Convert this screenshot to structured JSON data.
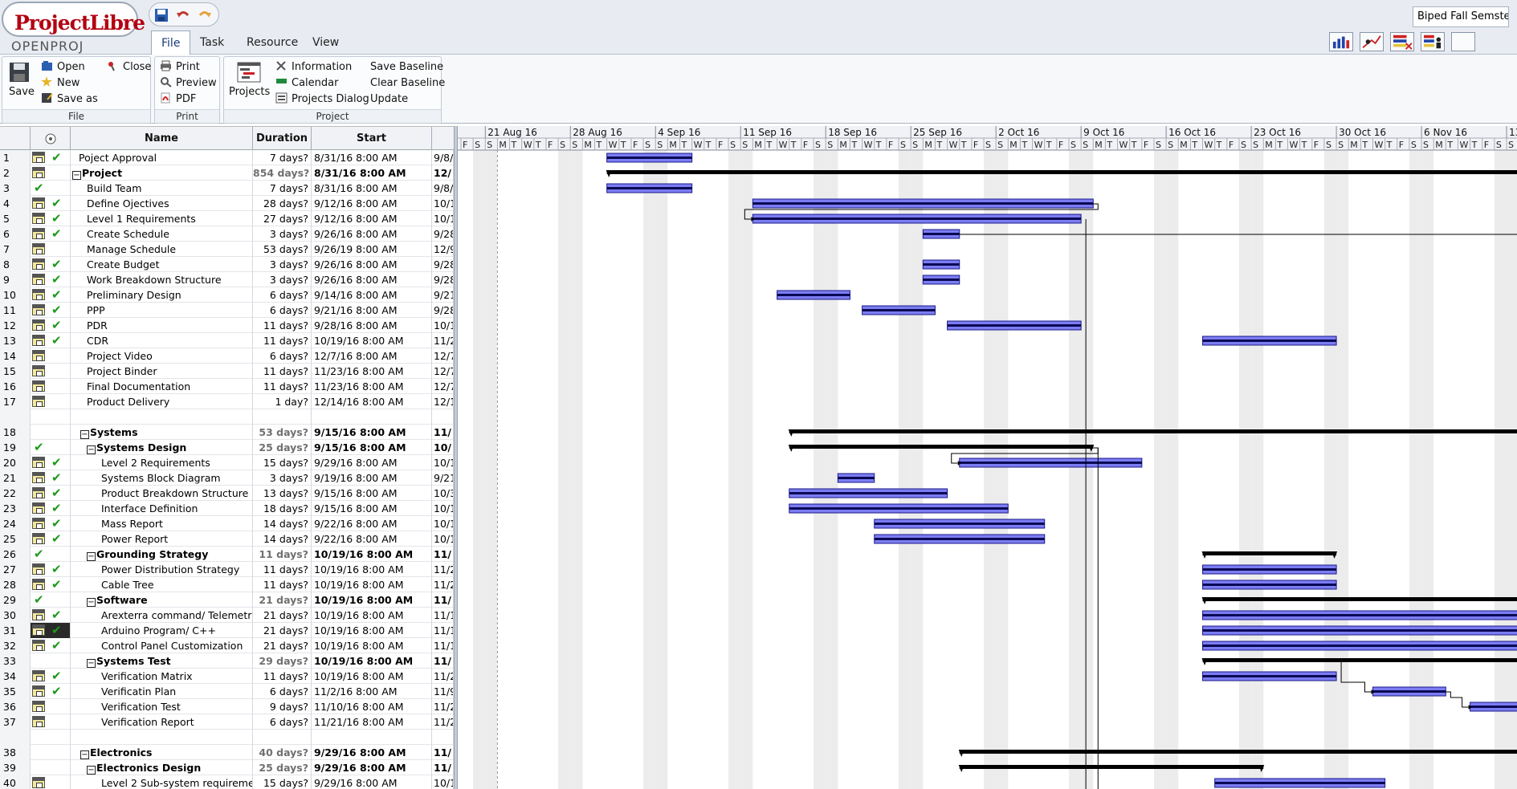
{
  "app": {
    "logo_text": "ProjectLibre",
    "logo_sub": "OPENPROJ",
    "document_name": "Biped Fall Semste..."
  },
  "tabs": [
    {
      "label": "File",
      "active": true
    },
    {
      "label": "Task",
      "active": false
    },
    {
      "label": "Resource",
      "active": false
    },
    {
      "label": "View",
      "active": false
    }
  ],
  "ribbon": {
    "file_group": {
      "label": "File",
      "save": "Save",
      "open": "Open",
      "close": "Close",
      "new": "New",
      "save_as": "Save as"
    },
    "print_group": {
      "label": "Print",
      "print": "Print",
      "preview": "Preview",
      "pdf": "PDF"
    },
    "project_group": {
      "label": "Project",
      "projects": "Projects",
      "information": "Information",
      "calendar": "Calendar",
      "projects_dialog": "Projects Dialog",
      "save_baseline": "Save Baseline",
      "clear_baseline": "Clear Baseline",
      "update": "Update"
    }
  },
  "columns": {
    "name": "Name",
    "duration": "Duration",
    "start": "Start"
  },
  "timeline": {
    "weeks": [
      "21 Aug 16",
      "28 Aug 16",
      "4 Sep 16",
      "11 Sep 16",
      "18 Sep 16",
      "25 Sep 16",
      "2 Oct 16",
      "9 Oct 16",
      "16 Oct 16",
      "23 Oct 16",
      "30 Oct 16",
      "6 Nov 16",
      "13 N"
    ],
    "day_letters": [
      "S",
      "M",
      "T",
      "W",
      "T",
      "F",
      "S"
    ]
  },
  "tasks": [
    {
      "id": "1",
      "name": "Poject Approval",
      "duration": "7 days?",
      "start": "8/31/16 8:00 AM",
      "finish": "9/8/",
      "level": 1,
      "cal": true,
      "check": "b"
    },
    {
      "id": "2",
      "name": "Project",
      "duration": "854 days?",
      "start": "8/31/16 8:00 AM",
      "finish": "12/",
      "level": 0,
      "summary": true,
      "cal": true
    },
    {
      "id": "3",
      "name": "Build Team",
      "duration": "7 days?",
      "start": "8/31/16 8:00 AM",
      "finish": "9/8/",
      "level": 2,
      "check": "a"
    },
    {
      "id": "4",
      "name": "Define Ojectives",
      "duration": "28 days?",
      "start": "9/12/16 8:00 AM",
      "finish": "10/1",
      "level": 2,
      "cal": true,
      "check": "b"
    },
    {
      "id": "5",
      "name": "Level 1 Requirements",
      "duration": "27 days?",
      "start": "9/12/16 8:00 AM",
      "finish": "10/1",
      "level": 2,
      "cal": true,
      "check": "b"
    },
    {
      "id": "6",
      "name": "Create Schedule",
      "duration": "3 days?",
      "start": "9/26/16 8:00 AM",
      "finish": "9/28",
      "level": 2,
      "cal": true,
      "check": "b"
    },
    {
      "id": "7",
      "name": "Manage Schedule",
      "duration": "53 days?",
      "start": "9/26/19 8:00 AM",
      "finish": "12/9",
      "level": 2,
      "cal": true
    },
    {
      "id": "8",
      "name": "Create Budget",
      "duration": "3 days?",
      "start": "9/26/16 8:00 AM",
      "finish": "9/28",
      "level": 2,
      "cal": true,
      "check": "b"
    },
    {
      "id": "9",
      "name": "Work Breakdown Structure",
      "duration": "3 days?",
      "start": "9/26/16 8:00 AM",
      "finish": "9/28",
      "level": 2,
      "cal": true,
      "check": "b"
    },
    {
      "id": "10",
      "name": "Preliminary Design",
      "duration": "6 days?",
      "start": "9/14/16 8:00 AM",
      "finish": "9/21",
      "level": 2,
      "cal": true,
      "check": "b"
    },
    {
      "id": "11",
      "name": "PPP",
      "duration": "6 days?",
      "start": "9/21/16 8:00 AM",
      "finish": "9/28",
      "level": 2,
      "cal": true,
      "check": "b"
    },
    {
      "id": "12",
      "name": "PDR",
      "duration": "11 days?",
      "start": "9/28/16 8:00 AM",
      "finish": "10/1",
      "level": 2,
      "cal": true,
      "check": "b"
    },
    {
      "id": "13",
      "name": "CDR",
      "duration": "11 days?",
      "start": "10/19/16 8:00 AM",
      "finish": "11/2",
      "level": 2,
      "cal": true,
      "check": "b"
    },
    {
      "id": "14",
      "name": "Project Video",
      "duration": "6 days?",
      "start": "12/7/16 8:00 AM",
      "finish": "12/7",
      "level": 2,
      "cal": true
    },
    {
      "id": "15",
      "name": "Project Binder",
      "duration": "11 days?",
      "start": "11/23/16 8:00 AM",
      "finish": "12/7",
      "level": 2,
      "cal": true
    },
    {
      "id": "16",
      "name": "Final Documentation",
      "duration": "11 days?",
      "start": "11/23/16 8:00 AM",
      "finish": "12/7",
      "level": 2,
      "cal": true
    },
    {
      "id": "17",
      "name": "Product Delivery",
      "duration": "1 day?",
      "start": "12/14/16 8:00 AM",
      "finish": "12/1",
      "level": 2,
      "cal": true
    },
    {
      "id": "",
      "name": "",
      "duration": "",
      "start": "",
      "finish": "",
      "level": 0,
      "blank": true
    },
    {
      "id": "18",
      "name": "Systems",
      "duration": "53 days?",
      "start": "9/15/16 8:00 AM",
      "finish": "11/",
      "level": 1,
      "summary": true
    },
    {
      "id": "19",
      "name": "Systems Design",
      "duration": "25 days?",
      "start": "9/15/16 8:00 AM",
      "finish": "10/",
      "level": 2,
      "summary": true,
      "check": "a"
    },
    {
      "id": "20",
      "name": "Level 2 Requirements",
      "duration": "15 days?",
      "start": "9/29/16 8:00 AM",
      "finish": "10/1",
      "level": 3,
      "cal": true,
      "check": "b"
    },
    {
      "id": "21",
      "name": "Systems Block Diagram",
      "duration": "3 days?",
      "start": "9/19/16 8:00 AM",
      "finish": "9/21",
      "level": 3,
      "cal": true,
      "check": "b"
    },
    {
      "id": "22",
      "name": "Product Breakdown Structure",
      "duration": "13 days?",
      "start": "9/15/16 8:00 AM",
      "finish": "10/3",
      "level": 3,
      "cal": true,
      "check": "b"
    },
    {
      "id": "23",
      "name": "Interface Definition",
      "duration": "18 days?",
      "start": "9/15/16 8:00 AM",
      "finish": "10/1",
      "level": 3,
      "cal": true,
      "check": "b"
    },
    {
      "id": "24",
      "name": "Mass Report",
      "duration": "14 days?",
      "start": "9/22/16 8:00 AM",
      "finish": "10/1",
      "level": 3,
      "cal": true,
      "check": "b"
    },
    {
      "id": "25",
      "name": "Power Report",
      "duration": "14 days?",
      "start": "9/22/16 8:00 AM",
      "finish": "10/1",
      "level": 3,
      "cal": true,
      "check": "b"
    },
    {
      "id": "26",
      "name": "Grounding Strategy",
      "duration": "11 days?",
      "start": "10/19/16 8:00 AM",
      "finish": "11/",
      "level": 2,
      "summary": true,
      "check": "a"
    },
    {
      "id": "27",
      "name": "Power Distribution Strategy",
      "duration": "11 days?",
      "start": "10/19/16 8:00 AM",
      "finish": "11/2",
      "level": 3,
      "cal": true,
      "check": "b"
    },
    {
      "id": "28",
      "name": "Cable Tree",
      "duration": "11 days?",
      "start": "10/19/16 8:00 AM",
      "finish": "11/2",
      "level": 3,
      "cal": true,
      "check": "b"
    },
    {
      "id": "29",
      "name": "Software",
      "duration": "21 days?",
      "start": "10/19/16 8:00 AM",
      "finish": "11/",
      "level": 2,
      "summary": true,
      "check": "a"
    },
    {
      "id": "30",
      "name": "Arexterra command/ Telemetry",
      "duration": "21 days?",
      "start": "10/19/16 8:00 AM",
      "finish": "11/1",
      "level": 3,
      "cal": true,
      "check": "b"
    },
    {
      "id": "31",
      "name": "Arduino Program/ C++",
      "duration": "21 days?",
      "start": "10/19/16 8:00 AM",
      "finish": "11/1",
      "level": 3,
      "cal": true,
      "check": "b",
      "selected": true
    },
    {
      "id": "32",
      "name": "Control Panel Customization",
      "duration": "21 days?",
      "start": "10/19/16 8:00 AM",
      "finish": "11/1",
      "level": 3,
      "cal": true,
      "check": "b"
    },
    {
      "id": "33",
      "name": "Systems Test",
      "duration": "29 days?",
      "start": "10/19/16 8:00 AM",
      "finish": "11/",
      "level": 2,
      "summary": true
    },
    {
      "id": "34",
      "name": "Verification Matrix",
      "duration": "11 days?",
      "start": "10/19/16 8:00 AM",
      "finish": "11/2",
      "level": 3,
      "cal": true,
      "check": "b"
    },
    {
      "id": "35",
      "name": "Verificatin Plan",
      "duration": "6 days?",
      "start": "11/2/16 8:00 AM",
      "finish": "11/9",
      "level": 3,
      "cal": true,
      "check": "b"
    },
    {
      "id": "36",
      "name": "Verification Test",
      "duration": "9 days?",
      "start": "11/10/16 8:00 AM",
      "finish": "11/2",
      "level": 3,
      "cal": true
    },
    {
      "id": "37",
      "name": "Verification Report",
      "duration": "6 days?",
      "start": "11/21/16 8:00 AM",
      "finish": "11/2",
      "level": 3,
      "cal": true
    },
    {
      "id": "",
      "name": "",
      "duration": "",
      "start": "",
      "finish": "",
      "level": 0,
      "blank": true
    },
    {
      "id": "38",
      "name": "Electronics",
      "duration": "40 days?",
      "start": "9/29/16 8:00 AM",
      "finish": "11/",
      "level": 1,
      "summary": true
    },
    {
      "id": "39",
      "name": "Electronics Design",
      "duration": "25 days?",
      "start": "9/29/16 8:00 AM",
      "finish": "11/",
      "level": 2,
      "summary": true
    },
    {
      "id": "40",
      "name": "Level 2 Sub-system requirement",
      "duration": "15 days?",
      "start": "9/29/16 8:00 AM",
      "finish": "10/1",
      "level": 3,
      "cal": true
    }
  ],
  "bars": [
    {
      "row": 1,
      "start": "2016-08-31",
      "days": 7
    },
    {
      "row": 2,
      "start": "2016-08-31",
      "days": 700,
      "summary": true
    },
    {
      "row": 3,
      "start": "2016-08-31",
      "days": 7
    },
    {
      "row": 4,
      "start": "2016-09-12",
      "days": 28
    },
    {
      "row": 5,
      "start": "2016-09-12",
      "days": 27
    },
    {
      "row": 6,
      "start": "2016-09-26",
      "days": 3
    },
    {
      "row": 8,
      "start": "2016-09-26",
      "days": 3
    },
    {
      "row": 9,
      "start": "2016-09-26",
      "days": 3
    },
    {
      "row": 10,
      "start": "2016-09-14",
      "days": 6
    },
    {
      "row": 11,
      "start": "2016-09-21",
      "days": 6
    },
    {
      "row": 12,
      "start": "2016-09-28",
      "days": 11
    },
    {
      "row": 13,
      "start": "2016-10-19",
      "days": 11
    },
    {
      "row": 19,
      "start": "2016-09-15",
      "days": 300,
      "summary": true
    },
    {
      "row": 20,
      "start": "2016-09-15",
      "days": 25,
      "summary": true
    },
    {
      "row": 21,
      "start": "2016-09-29",
      "days": 15
    },
    {
      "row": 22,
      "start": "2016-09-19",
      "days": 3
    },
    {
      "row": 23,
      "start": "2016-09-15",
      "days": 13
    },
    {
      "row": 24,
      "start": "2016-09-15",
      "days": 18
    },
    {
      "row": 25,
      "start": "2016-09-22",
      "days": 14
    },
    {
      "row": 26,
      "start": "2016-09-22",
      "days": 14
    },
    {
      "row": 27,
      "start": "2016-10-19",
      "days": 11,
      "summary": true
    },
    {
      "row": 28,
      "start": "2016-10-19",
      "days": 11
    },
    {
      "row": 29,
      "start": "2016-10-19",
      "days": 11
    },
    {
      "row": 30,
      "start": "2016-10-19",
      "days": 300,
      "summary": true
    },
    {
      "row": 31,
      "start": "2016-10-19",
      "days": 300
    },
    {
      "row": 32,
      "start": "2016-10-19",
      "days": 300
    },
    {
      "row": 33,
      "start": "2016-10-19",
      "days": 300
    },
    {
      "row": 34,
      "start": "2016-10-19",
      "days": 300,
      "summary": true
    },
    {
      "row": 35,
      "start": "2016-10-19",
      "days": 11
    },
    {
      "row": 36,
      "start": "2016-11-02",
      "days": 6
    },
    {
      "row": 37,
      "start": "2016-11-10",
      "days": 60
    },
    {
      "row": 40,
      "start": "2016-09-29",
      "days": 300,
      "summary": true
    },
    {
      "row": 41,
      "start": "2016-09-29",
      "days": 25,
      "summary": true
    },
    {
      "row": 42,
      "start": "2016-10-20",
      "days": 14
    }
  ]
}
